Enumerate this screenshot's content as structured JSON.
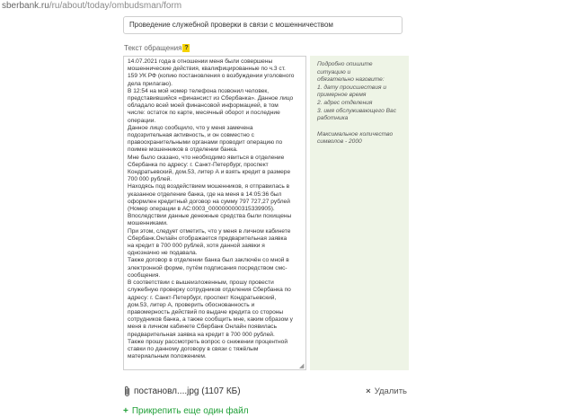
{
  "browser": {
    "url_host": "sberbank.ru",
    "url_path": "/ru/about/today/ombudsman/form"
  },
  "form": {
    "subject_value": "Проведение служебной проверки в связи с мошенничеством",
    "message_label": "Текст обращения",
    "message_value": "14.07.2021 года в отношении меня были совершены мошеннические действия, квалифицированные по ч.3 ст. 159 УК РФ (копию постановления о возбуждении уголовного дела прилагаю).\nВ 12:54 на мой номер телефона позвонил человек, представившийся «финансист из Сбербанка». Данное лицо обладало всей моей финансовой информацией, в том числе: остаток по карте, месячный оборот и последние операции.\nДанное лицо сообщило, что у меня замечена подозрительная активность, и он совместно с правоохранительными органами проводит операцию по поимке мошенников в отделении банка.\nМне было сказано, что необходимо явиться в отделение Сбербанка по адресу: г. Санкт-Петербург, проспект Кондратьевский, дом.53, литер А и взять кредит в размере 700 000 рублей.\nНаходясь под воздействием мошенников, я отправилась в указанное отделение банка, где на меня в 14:05:36 был оформлен кредитный договор на сумму 797 727,27 рублей (Номер операции в АС:0003_0000000000315339905).\nВпоследствии данные денежные средства были похищены мошенниками.\nПри этом, следует отметить, что у меня в личном кабинете Сбербанк.Онлайн отображается предварительная заявка на кредит в 700 000 рублей, хотя данной заявки я однозначно не подавала.\nТакже договор в отделении банка был заключён со мной в электронной форме, путём подписания посредством смс-сообщения.\nВ соответствии с вышеизложенным, прошу провести служебную проверку сотрудников отделения Сбербанка по адресу: г. Санкт-Петербург, проспект Кондратьевский, дом.53, литер А, проверить обоснованность и правомерность действий по выдаче кредита со стороны сотрудников банка, а также сообщить мне, каким образом у меня в личном кабинете Сбербанк Онлайн появилась предварительная заявка на кредит в 700 000 рублей.\nТакже прошу рассмотреть вопрос о снижении процентной ставки по данному договору в связи с тяжёлым материальным положением."
  },
  "hint": {
    "intro_1": "Подробно опишите ситуацию и",
    "intro_2": "обязательно назовите:",
    "item_1a": "1. дату происшествия и",
    "item_1b": "примерное время",
    "item_2": "2. адрес отделения",
    "item_3a": "3. имя обслуживающего Вас",
    "item_3b": "работника",
    "limit_1": "Максимальное количество",
    "limit_2": "символов - 2000"
  },
  "attachment": {
    "file_name": "постановл....jpg (1107 КБ)",
    "remove_label": "Удалить"
  },
  "add_file": {
    "label": "Прикрепить еще один файл"
  },
  "colors": {
    "accent_green": "#21a038",
    "hint_bg": "#eef4e6",
    "help_icon_bg": "#f5d300"
  },
  "icons": {
    "help": "?",
    "paperclip": "paperclip-icon",
    "remove": "×",
    "add": "+"
  }
}
